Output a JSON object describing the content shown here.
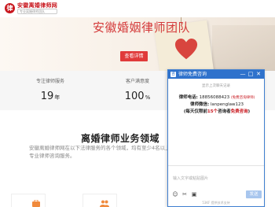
{
  "header": {
    "logo_mark": "律",
    "logo_title": "安徽离婚律师网",
    "logo_sub": "专业离婚律师团队"
  },
  "banner": {
    "title": "安徽婚姻律师团队",
    "button_label": "查看详情"
  },
  "stats": [
    {
      "label": "专注律师服务",
      "value": "19",
      "unit": "年"
    },
    {
      "label": "客户满意度",
      "value": "100",
      "unit": "%"
    }
  ],
  "services": {
    "title": "离婚律师业务领域",
    "description": "安徽离婚律师网在以下法律服务的各个领域，均有至少4名以上专业律师咨询服务。"
  },
  "chat": {
    "title": "律师免费咨询",
    "head_icon": "咨",
    "minimize": "—",
    "maximize": "□",
    "close": "✕",
    "history": "显示上次聊天记录",
    "phone_label": "律师电话:",
    "phone_value": "18856088423",
    "phone_note": "(免费咨询律师)",
    "wechat_label": "律师微信:",
    "wechat_value": "lanpenglaw123",
    "limit_prefix": "(每天仅限前",
    "limit_count": "15个",
    "limit_mid": "咨询者",
    "limit_free": "免费咨询",
    "limit_suffix": ")",
    "placeholder": "输入文字或粘贴图片",
    "send_label": "发送",
    "footer": "53KF 提供技术支持"
  },
  "colors": {
    "brand_red": "#c8161d",
    "chat_blue": "#2f72cc"
  }
}
